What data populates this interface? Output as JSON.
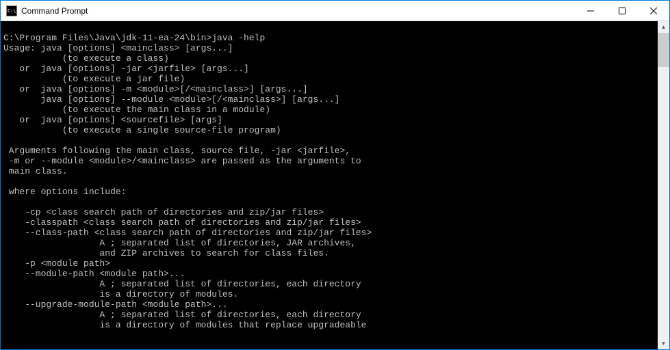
{
  "window": {
    "title": "Command Prompt",
    "icon_label": "C:\\"
  },
  "terminal": {
    "lines": [
      "",
      "C:\\Program Files\\Java\\jdk-11-ea-24\\bin>java -help",
      "Usage: java [options] <mainclass> [args...]",
      "           (to execute a class)",
      "   or  java [options] -jar <jarfile> [args...]",
      "           (to execute a jar file)",
      "   or  java [options] -m <module>[/<mainclass>] [args...]",
      "       java [options] --module <module>[/<mainclass>] [args...]",
      "           (to execute the main class in a module)",
      "   or  java [options] <sourcefile> [args]",
      "           (to execute a single source-file program)",
      "",
      " Arguments following the main class, source file, -jar <jarfile>,",
      " -m or --module <module>/<mainclass> are passed as the arguments to",
      " main class.",
      "",
      " where options include:",
      "",
      "    -cp <class search path of directories and zip/jar files>",
      "    -classpath <class search path of directories and zip/jar files>",
      "    --class-path <class search path of directories and zip/jar files>",
      "                  A ; separated list of directories, JAR archives,",
      "                  and ZIP archives to search for class files.",
      "    -p <module path>",
      "    --module-path <module path>...",
      "                  A ; separated list of directories, each directory",
      "                  is a directory of modules.",
      "    --upgrade-module-path <module path>...",
      "                  A ; separated list of directories, each directory",
      "                  is a directory of modules that replace upgradeable"
    ]
  }
}
